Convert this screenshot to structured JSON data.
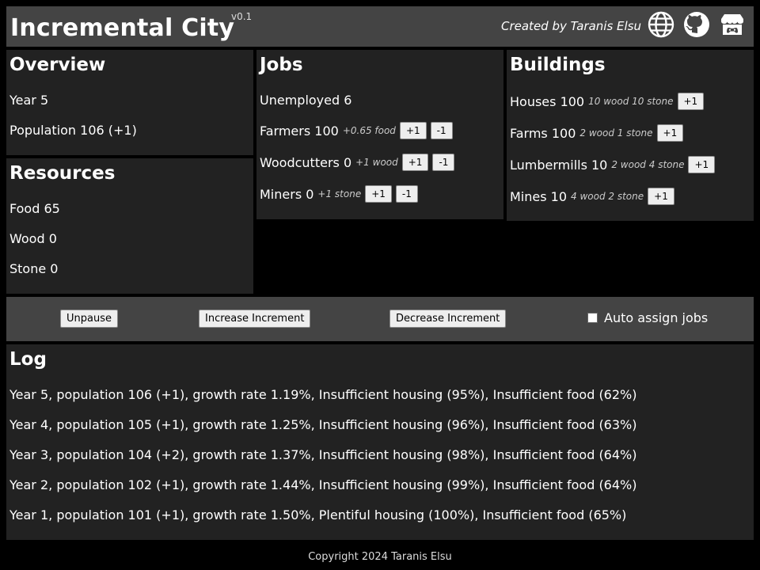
{
  "header": {
    "title": "Incremental City",
    "version": "v0.1",
    "credit": "Created by Taranis Elsu",
    "icons": [
      "globe-icon",
      "github-icon",
      "itch-store-icon"
    ]
  },
  "overview": {
    "title": "Overview",
    "year": "Year 5",
    "population": "Population 106 (+1)"
  },
  "resources": {
    "title": "Resources",
    "food": "Food 65",
    "wood": "Wood 0",
    "stone": "Stone 0"
  },
  "jobs": {
    "title": "Jobs",
    "unemployed": "Unemployed 6",
    "items": [
      {
        "label": "Farmers 100",
        "note": "+0.65 food",
        "plus": "+1",
        "minus": "-1"
      },
      {
        "label": "Woodcutters 0",
        "note": "+1 wood",
        "plus": "+1",
        "minus": "-1"
      },
      {
        "label": "Miners 0",
        "note": "+1 stone",
        "plus": "+1",
        "minus": "-1"
      }
    ]
  },
  "buildings": {
    "title": "Buildings",
    "items": [
      {
        "label": "Houses 100",
        "note": "10 wood 10 stone",
        "plus": "+1"
      },
      {
        "label": "Farms 100",
        "note": "2 wood 1 stone",
        "plus": "+1"
      },
      {
        "label": "Lumbermills 10",
        "note": "2 wood 4 stone",
        "plus": "+1"
      },
      {
        "label": "Mines 10",
        "note": "4 wood 2 stone",
        "plus": "+1"
      }
    ]
  },
  "controls": {
    "unpause": "Unpause",
    "increase": "Increase Increment",
    "decrease": "Decrease Increment",
    "auto_assign": "Auto assign jobs",
    "auto_assign_checked": false
  },
  "log": {
    "title": "Log",
    "lines": [
      "Year 5, population 106 (+1), growth rate 1.19%, Insufficient housing (95%), Insufficient food (62%)",
      "Year 4, population 105 (+1), growth rate 1.25%, Insufficient housing (96%), Insufficient food (63%)",
      "Year 3, population 104 (+2), growth rate 1.37%, Insufficient housing (98%), Insufficient food (64%)",
      "Year 2, population 102 (+1), growth rate 1.44%, Insufficient housing (99%), Insufficient food (64%)",
      "Year 1, population 101 (+1), growth rate 1.50%, Plentiful housing (100%), Insufficient food (65%)"
    ]
  },
  "footer": "Copyright 2024 Taranis Elsu"
}
